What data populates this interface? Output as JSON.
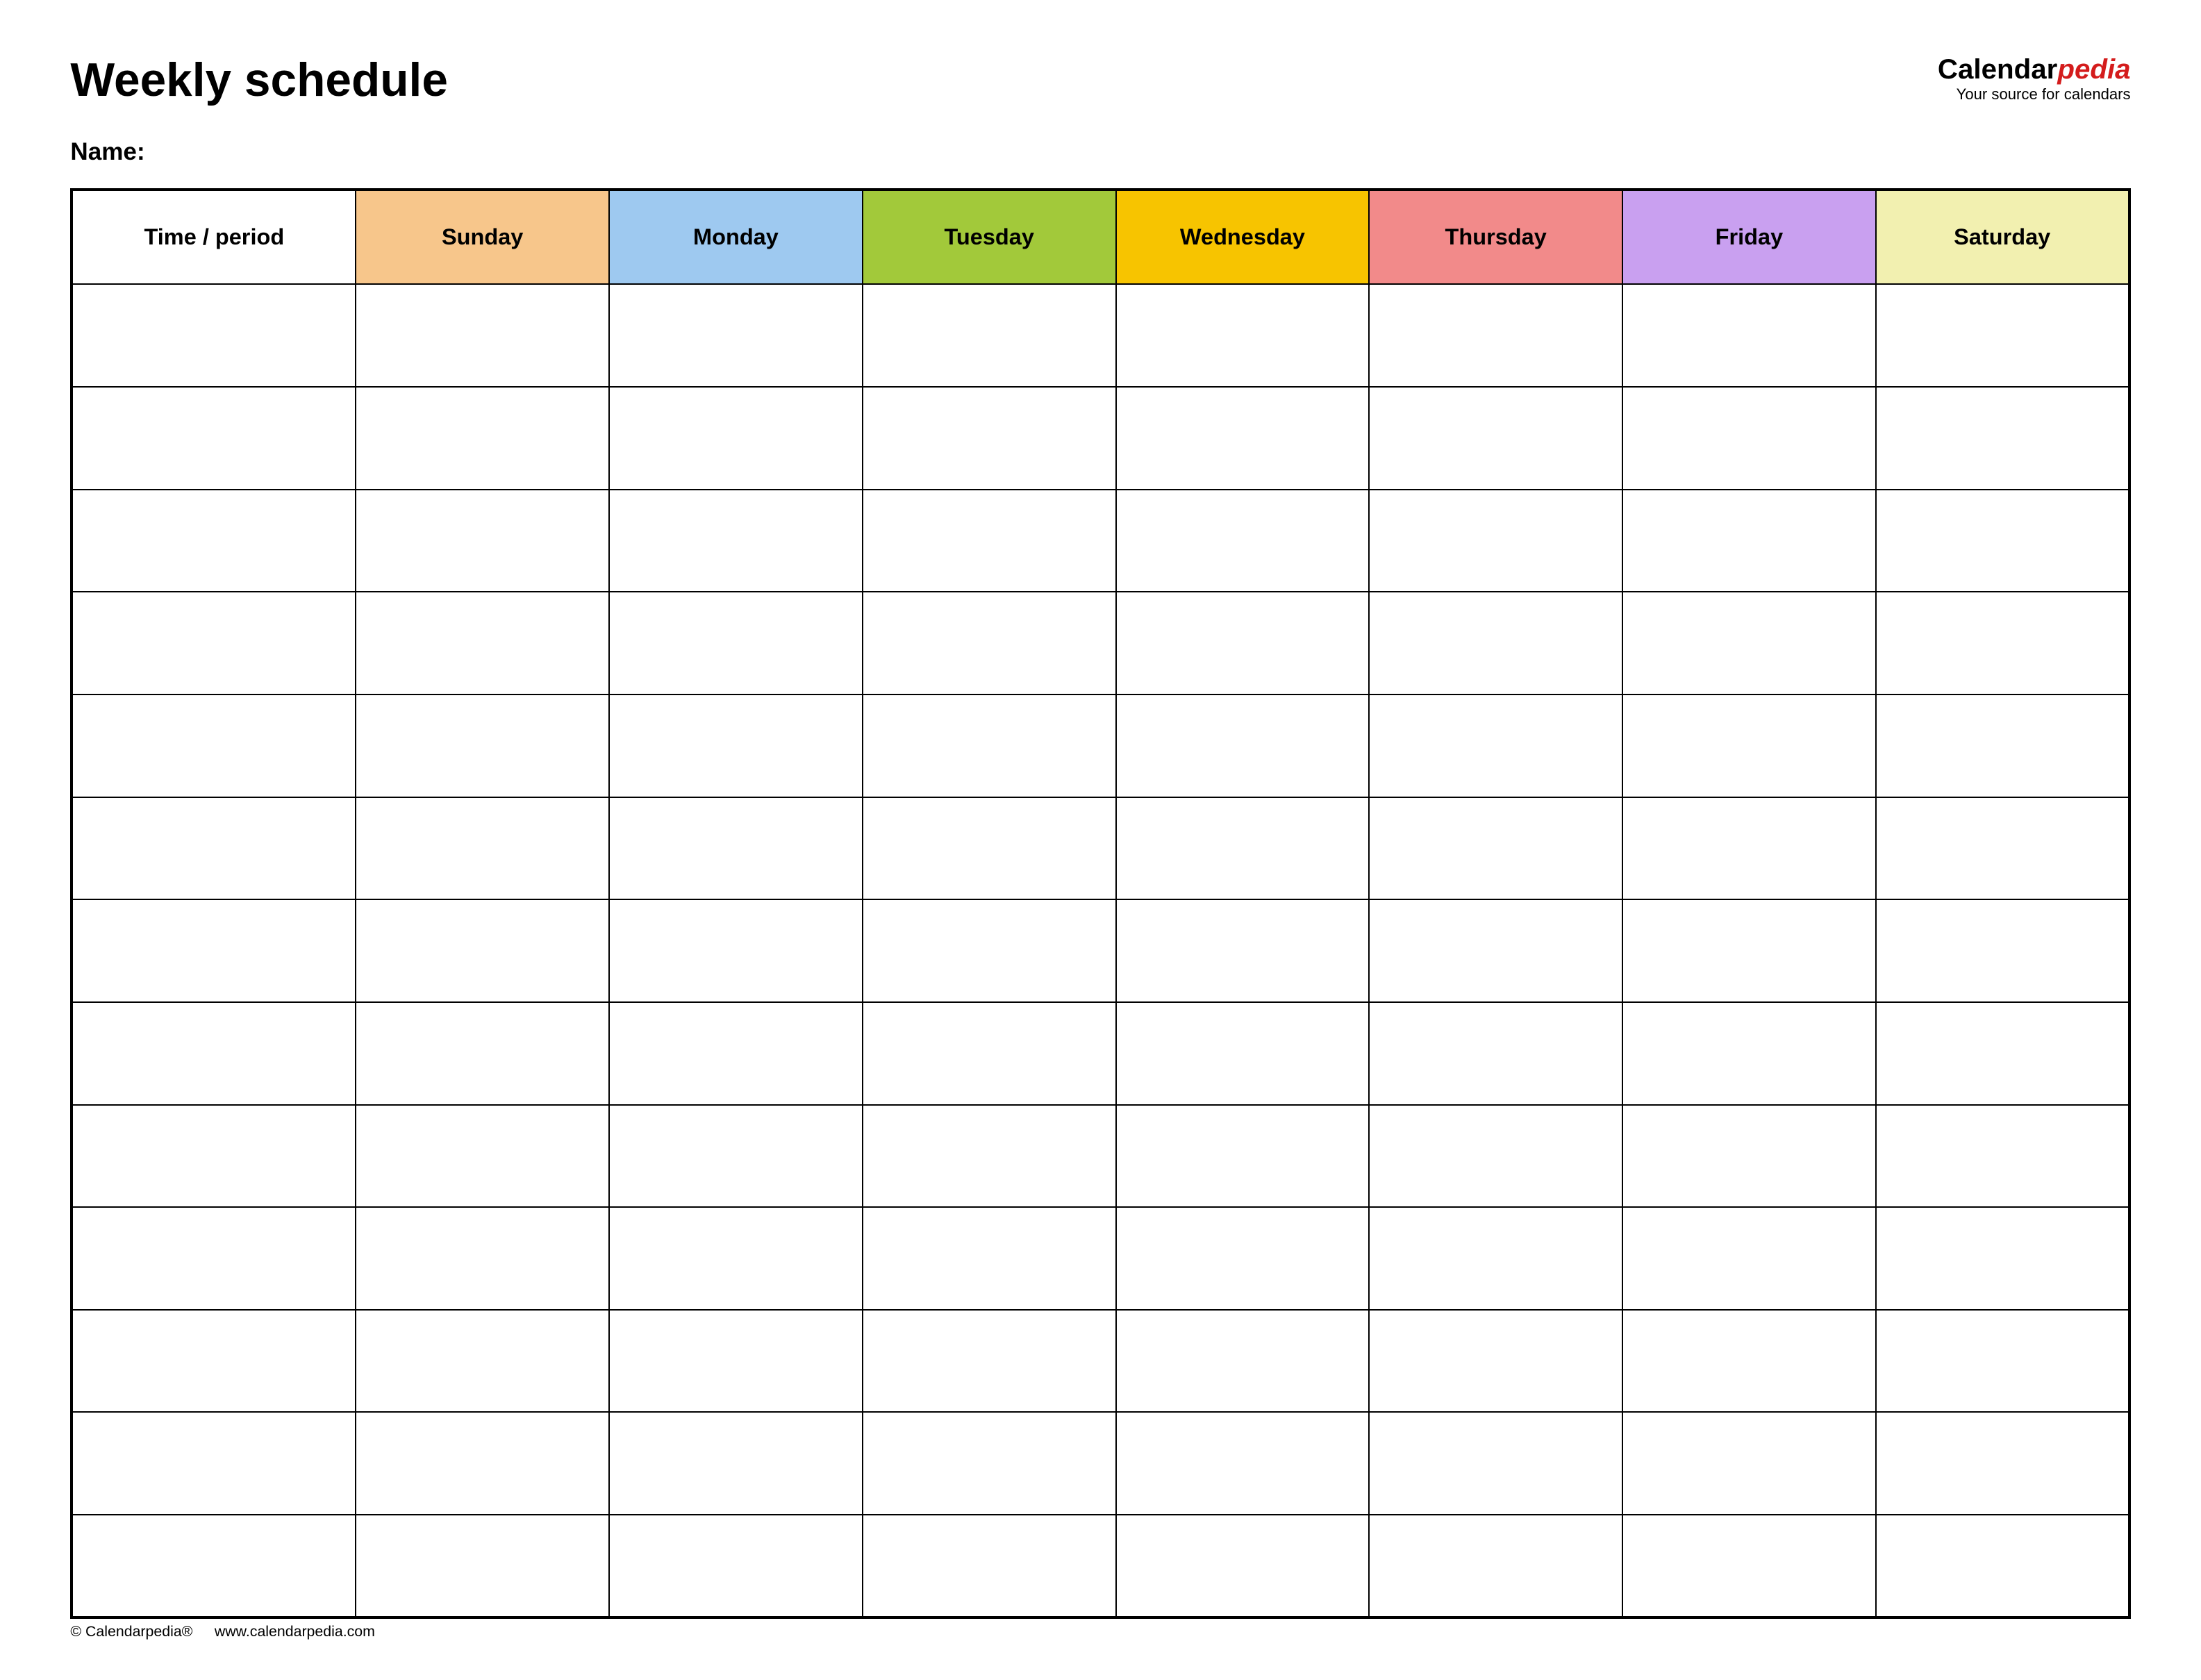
{
  "title": "Weekly schedule",
  "name_label": "Name:",
  "brand": {
    "part1": "Calendar",
    "part2": "pedia",
    "tagline": "Your source for calendars"
  },
  "headers": {
    "time": "Time / period",
    "days": [
      {
        "label": "Sunday",
        "color": "#f7c68b"
      },
      {
        "label": "Monday",
        "color": "#9ec9f0"
      },
      {
        "label": "Tuesday",
        "color": "#a2c93a"
      },
      {
        "label": "Wednesday",
        "color": "#f7c400"
      },
      {
        "label": "Thursday",
        "color": "#f28a8a"
      },
      {
        "label": "Friday",
        "color": "#c9a0f0"
      },
      {
        "label": "Saturday",
        "color": "#f2f0b0"
      }
    ]
  },
  "row_count": 13,
  "footer": {
    "copyright": "© Calendarpedia®",
    "url": "www.calendarpedia.com"
  }
}
